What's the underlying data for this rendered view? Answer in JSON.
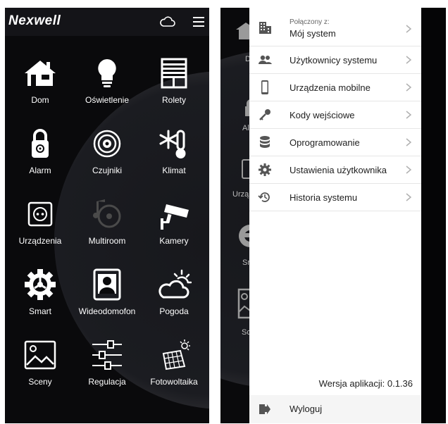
{
  "app": {
    "logo_text": "Nexwell"
  },
  "home_grid": {
    "tiles": [
      {
        "label": "Dom",
        "icon": "house-icon"
      },
      {
        "label": "Oświetlenie",
        "icon": "bulb-icon"
      },
      {
        "label": "Rolety",
        "icon": "blinds-icon"
      },
      {
        "label": "Alarm",
        "icon": "padlock-icon"
      },
      {
        "label": "Czujniki",
        "icon": "sensor-icon"
      },
      {
        "label": "Klimat",
        "icon": "thermometer-snow-icon"
      },
      {
        "label": "Urządzenia",
        "icon": "socket-icon"
      },
      {
        "label": "Multiroom",
        "icon": "music-disc-icon"
      },
      {
        "label": "Kamery",
        "icon": "camera-icon"
      },
      {
        "label": "Smart",
        "icon": "gear-icon"
      },
      {
        "label": "Wideodomofon",
        "icon": "intercom-icon"
      },
      {
        "label": "Pogoda",
        "icon": "weather-icon"
      },
      {
        "label": "Sceny",
        "icon": "image-icon"
      },
      {
        "label": "Regulacja",
        "icon": "sliders-icon"
      },
      {
        "label": "Fotowoltaika",
        "icon": "solar-panel-icon"
      }
    ]
  },
  "drawer": {
    "connected_label": "Połączony z:",
    "connected_value": "Mój system",
    "items": [
      {
        "label": "Użytkownicy systemu",
        "icon": "users-icon"
      },
      {
        "label": "Urządzenia mobilne",
        "icon": "phone-icon"
      },
      {
        "label": "Kody wejściowe",
        "icon": "key-icon"
      },
      {
        "label": "Oprogramowanie",
        "icon": "database-icon"
      },
      {
        "label": "Ustawienia użytkownika",
        "icon": "settings-icon"
      },
      {
        "label": "Historia systemu",
        "icon": "history-icon"
      }
    ],
    "version": "Wersja aplikacji: 0.1.36",
    "logout": "Wyloguj"
  },
  "colors": {
    "accent": "#141418",
    "drawer_icon": "#555555",
    "background": "#0a0a0c"
  }
}
